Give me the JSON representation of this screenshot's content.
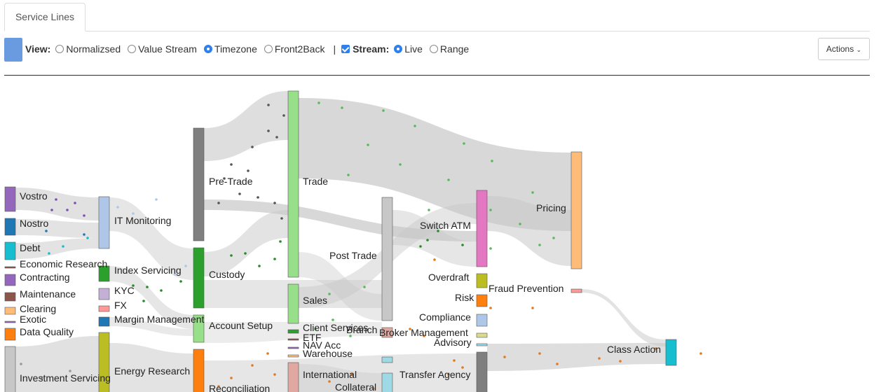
{
  "tabs": [
    {
      "label": "Service Lines"
    }
  ],
  "toolbar": {
    "view_label": "View:",
    "view_options": [
      "Normalizsed",
      "Value Stream",
      "Timezone",
      "Front2Back"
    ],
    "view_selected": "Timezone",
    "separator": "|",
    "stream_label": "Stream:",
    "stream_checked": true,
    "stream_options": [
      "Live",
      "Range"
    ],
    "stream_selected": "Live",
    "actions_label": "Actions",
    "actions_icon": "chevron-down-icon"
  },
  "colors": {
    "accent": "#2f80ed",
    "view_swatch": "#6a9be0",
    "rule": "#1a1ab8",
    "link": "#c8c8c8"
  },
  "sankey_nodes": [
    {
      "id": "vostro",
      "label": "Vostro",
      "color": "#9467bd"
    },
    {
      "id": "nostro",
      "label": "Nostro",
      "color": "#1f77b4"
    },
    {
      "id": "debt",
      "label": "Debt",
      "color": "#17becf"
    },
    {
      "id": "econ",
      "label": "Economic Research",
      "color": "#8c564b"
    },
    {
      "id": "contracting",
      "label": "Contracting",
      "color": "#9467bd"
    },
    {
      "id": "maintenance",
      "label": "Maintenance",
      "color": "#8c564b"
    },
    {
      "id": "clearing",
      "label": "Clearing",
      "color": "#ffbb78"
    },
    {
      "id": "exotic",
      "label": "Exotic",
      "color": "#9467bd"
    },
    {
      "id": "dataq",
      "label": "Data Quality",
      "color": "#ff7f0e"
    },
    {
      "id": "invsvc",
      "label": "Investment Servicing",
      "color": "#c7c7c7"
    },
    {
      "id": "itmon",
      "label": "IT Monitoring",
      "color": "#aec7e8"
    },
    {
      "id": "indexsvc",
      "label": "Index Servicing",
      "color": "#2ca02c"
    },
    {
      "id": "kyc",
      "label": "KYC",
      "color": "#c5b0d5"
    },
    {
      "id": "fx",
      "label": "FX",
      "color": "#ff9896"
    },
    {
      "id": "margin",
      "label": "Margin Management",
      "color": "#1f77b4"
    },
    {
      "id": "energy",
      "label": "Energy Research",
      "color": "#bcbd22"
    },
    {
      "id": "pretrade",
      "label": "Pre-Trade",
      "color": "#7f7f7f"
    },
    {
      "id": "custody",
      "label": "Custody",
      "color": "#2ca02c"
    },
    {
      "id": "acctsetup",
      "label": "Account Setup",
      "color": "#98df8a"
    },
    {
      "id": "recon",
      "label": "Reconciliation",
      "color": "#ff7f0e"
    },
    {
      "id": "trade",
      "label": "Trade",
      "color": "#98df8a"
    },
    {
      "id": "sales",
      "label": "Sales",
      "color": "#98df8a"
    },
    {
      "id": "clientsvc",
      "label": "Client Services",
      "color": "#2ca02c"
    },
    {
      "id": "etf",
      "label": "ETF",
      "color": "#8c564b"
    },
    {
      "id": "navacc",
      "label": "NAV Acc",
      "color": "#9467bd"
    },
    {
      "id": "warehouse",
      "label": "Warehouse",
      "color": "#ffbb78"
    },
    {
      "id": "intl",
      "label": "International",
      "color": "#e0a8a0"
    },
    {
      "id": "collateral",
      "label": "Collateral",
      "color": "#9edae5"
    },
    {
      "id": "posttrade",
      "label": "Post Trade",
      "color": "#c7c7c7"
    },
    {
      "id": "branch",
      "label": "Branch",
      "color": "#e0a8a0"
    },
    {
      "id": "transfer",
      "label": "Transfer Agency",
      "color": "#9edae5"
    },
    {
      "id": "switchatm",
      "label": "Switch ATM",
      "color": "#e377c2"
    },
    {
      "id": "overdraft",
      "label": "Overdraft",
      "color": "#bcbd22"
    },
    {
      "id": "risk",
      "label": "Risk",
      "color": "#ff7f0e"
    },
    {
      "id": "compliance",
      "label": "Compliance",
      "color": "#aec7e8"
    },
    {
      "id": "broker",
      "label": "Broker Management",
      "color": "#dbdb8d"
    },
    {
      "id": "advisory",
      "label": "Advisory",
      "color": "#9edae5"
    },
    {
      "id": "pricing",
      "label": "Pricing",
      "color": "#ffbb78"
    },
    {
      "id": "fraud",
      "label": "Fraud Prevention",
      "color": "#ff9896"
    },
    {
      "id": "classaction",
      "label": "Class Action",
      "color": "#17becf"
    }
  ]
}
